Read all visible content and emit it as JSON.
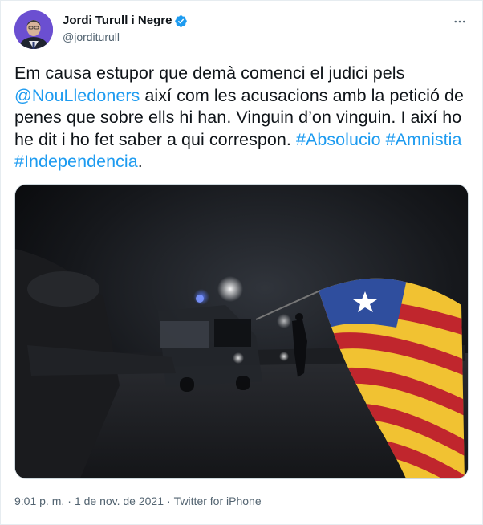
{
  "author": {
    "display_name": "Jordi Turull i Negre",
    "handle": "@jorditurull",
    "verified": true
  },
  "tweet": {
    "text_parts": {
      "p1": "Em causa estupor que demà comenci el judici pels ",
      "mention": "@NouLledoners",
      "p2": " així com les acusacions amb la petició de penes que sobre ells hi han. Vinguin  d’on vinguin. I així ho he dit i ho fet saber a qui correspon. ",
      "hashtag1": "#Absolucio",
      "space1": " ",
      "hashtag2": "#Amnistia",
      "space2": " ",
      "hashtag3": "#Independencia",
      "p3": "."
    },
    "media": {
      "description_icon": "photo"
    }
  },
  "footer": {
    "time": "9:01 p. m.",
    "separator1": "·",
    "date": "1 de nov. de 2021",
    "separator2": "·",
    "source": "Twitter for iPhone"
  },
  "colors": {
    "link": "#1d9bf0",
    "secondary_text": "#536471",
    "verified": "#1d9bf0"
  },
  "icons": {
    "more": "more-horizontal-icon",
    "verified": "verified-badge-icon"
  }
}
